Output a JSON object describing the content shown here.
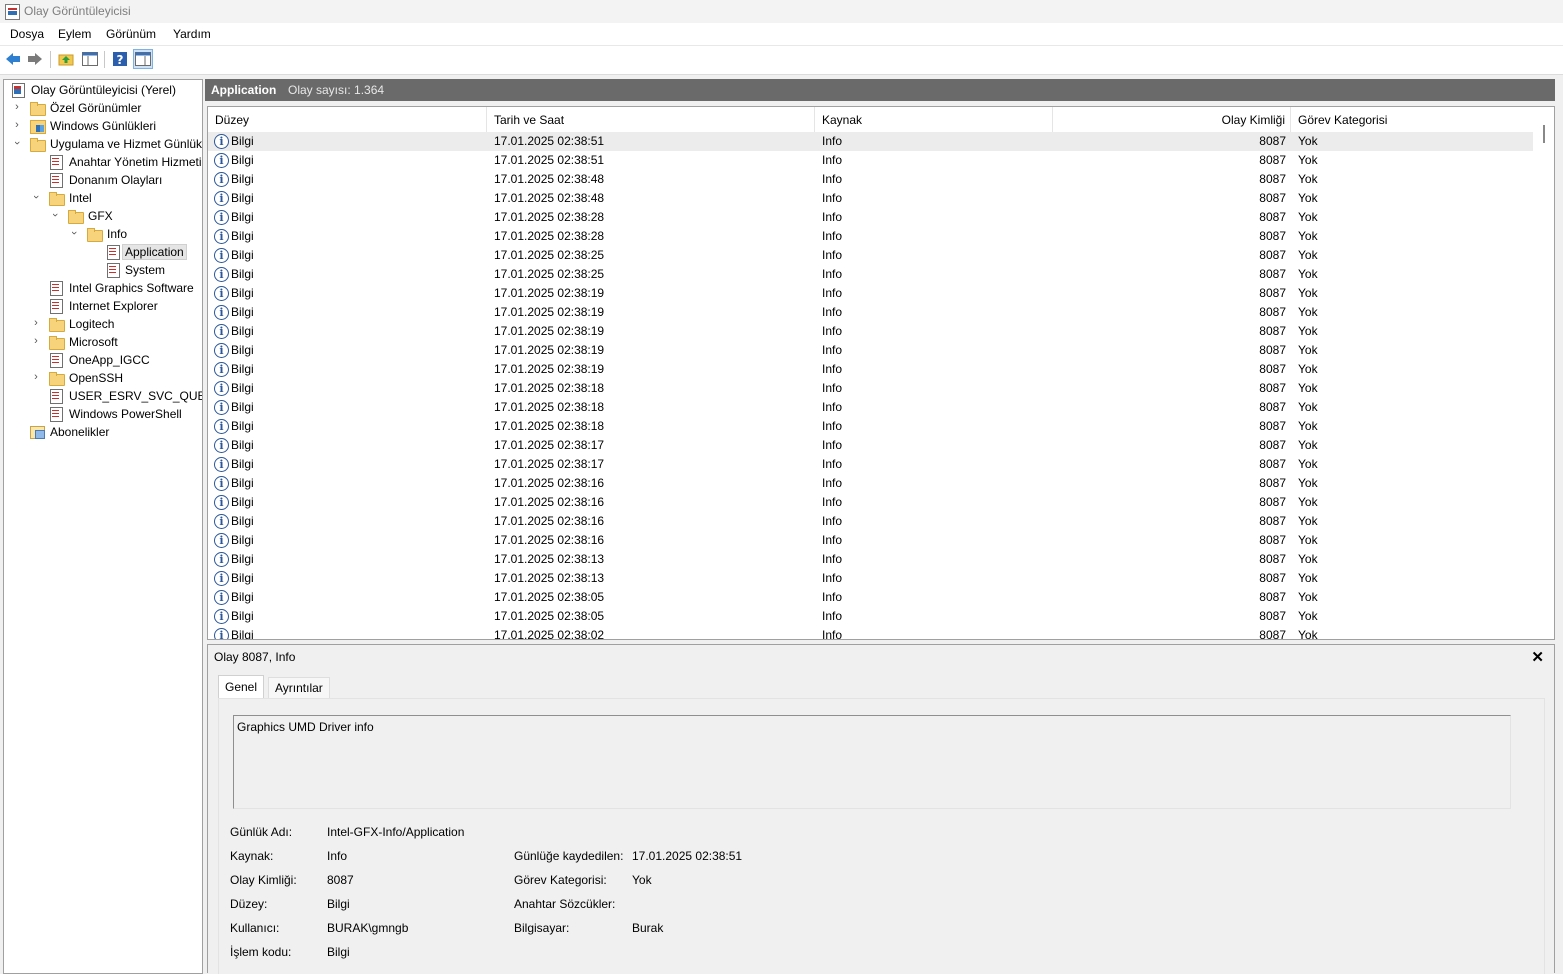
{
  "window": {
    "title": "Olay Görüntüleyicisi"
  },
  "menu": [
    "Dosya",
    "Eylem",
    "Görünüm",
    "Yardım"
  ],
  "toolbar": {
    "buttons": [
      "back-icon",
      "forward-icon",
      "up-folder-icon",
      "show-hide-tree-icon",
      "help-icon",
      "action-pane-icon"
    ]
  },
  "tree": {
    "items": [
      {
        "label": "Olay Görüntüleyicisi (Yerel)"
      },
      {
        "label": "Özel Görünümler"
      },
      {
        "label": "Windows Günlükleri"
      },
      {
        "label": "Uygulama ve Hizmet Günlükleri"
      },
      {
        "label": "Anahtar Yönetim Hizmeti"
      },
      {
        "label": "Donanım Olayları"
      },
      {
        "label": "Intel"
      },
      {
        "label": "GFX"
      },
      {
        "label": "Info"
      },
      {
        "label": "Application"
      },
      {
        "label": "System"
      },
      {
        "label": "Intel Graphics Software"
      },
      {
        "label": "Internet Explorer"
      },
      {
        "label": "Logitech"
      },
      {
        "label": "Microsoft"
      },
      {
        "label": "OneApp_IGCC"
      },
      {
        "label": "OpenSSH"
      },
      {
        "label": "USER_ESRV_SVC_QUEENCREEK"
      },
      {
        "label": "Windows PowerShell"
      },
      {
        "label": "Abonelikler"
      }
    ]
  },
  "panel": {
    "name": "Application",
    "count_text": "Olay sayısı: 1.364"
  },
  "grid": {
    "columns": [
      "Düzey",
      "Tarih ve Saat",
      "Kaynak",
      "Olay Kimliği",
      "Görev Kategorisi"
    ],
    "rows": [
      [
        "Bilgi",
        "17.01.2025 02:38:51",
        "Info",
        "8087",
        "Yok"
      ],
      [
        "Bilgi",
        "17.01.2025 02:38:51",
        "Info",
        "8087",
        "Yok"
      ],
      [
        "Bilgi",
        "17.01.2025 02:38:48",
        "Info",
        "8087",
        "Yok"
      ],
      [
        "Bilgi",
        "17.01.2025 02:38:48",
        "Info",
        "8087",
        "Yok"
      ],
      [
        "Bilgi",
        "17.01.2025 02:38:28",
        "Info",
        "8087",
        "Yok"
      ],
      [
        "Bilgi",
        "17.01.2025 02:38:28",
        "Info",
        "8087",
        "Yok"
      ],
      [
        "Bilgi",
        "17.01.2025 02:38:25",
        "Info",
        "8087",
        "Yok"
      ],
      [
        "Bilgi",
        "17.01.2025 02:38:25",
        "Info",
        "8087",
        "Yok"
      ],
      [
        "Bilgi",
        "17.01.2025 02:38:19",
        "Info",
        "8087",
        "Yok"
      ],
      [
        "Bilgi",
        "17.01.2025 02:38:19",
        "Info",
        "8087",
        "Yok"
      ],
      [
        "Bilgi",
        "17.01.2025 02:38:19",
        "Info",
        "8087",
        "Yok"
      ],
      [
        "Bilgi",
        "17.01.2025 02:38:19",
        "Info",
        "8087",
        "Yok"
      ],
      [
        "Bilgi",
        "17.01.2025 02:38:19",
        "Info",
        "8087",
        "Yok"
      ],
      [
        "Bilgi",
        "17.01.2025 02:38:18",
        "Info",
        "8087",
        "Yok"
      ],
      [
        "Bilgi",
        "17.01.2025 02:38:18",
        "Info",
        "8087",
        "Yok"
      ],
      [
        "Bilgi",
        "17.01.2025 02:38:18",
        "Info",
        "8087",
        "Yok"
      ],
      [
        "Bilgi",
        "17.01.2025 02:38:17",
        "Info",
        "8087",
        "Yok"
      ],
      [
        "Bilgi",
        "17.01.2025 02:38:17",
        "Info",
        "8087",
        "Yok"
      ],
      [
        "Bilgi",
        "17.01.2025 02:38:16",
        "Info",
        "8087",
        "Yok"
      ],
      [
        "Bilgi",
        "17.01.2025 02:38:16",
        "Info",
        "8087",
        "Yok"
      ],
      [
        "Bilgi",
        "17.01.2025 02:38:16",
        "Info",
        "8087",
        "Yok"
      ],
      [
        "Bilgi",
        "17.01.2025 02:38:16",
        "Info",
        "8087",
        "Yok"
      ],
      [
        "Bilgi",
        "17.01.2025 02:38:13",
        "Info",
        "8087",
        "Yok"
      ],
      [
        "Bilgi",
        "17.01.2025 02:38:13",
        "Info",
        "8087",
        "Yok"
      ],
      [
        "Bilgi",
        "17.01.2025 02:38:05",
        "Info",
        "8087",
        "Yok"
      ],
      [
        "Bilgi",
        "17.01.2025 02:38:05",
        "Info",
        "8087",
        "Yok"
      ],
      [
        "Bilgi",
        "17.01.2025 02:38:02",
        "Info",
        "8087",
        "Yok"
      ]
    ]
  },
  "detail": {
    "title": "Olay 8087, Info",
    "close": "✕",
    "tabs": [
      "Genel",
      "Ayrıntılar"
    ],
    "message": "Graphics UMD Driver info",
    "fields": {
      "log_name_label": "Günlük Adı:",
      "log_name": "Intel-GFX-Info/Application",
      "source_label": "Kaynak:",
      "source": "Info",
      "logged_label": "Günlüğe kaydedilen:",
      "logged": "17.01.2025 02:38:51",
      "event_id_label": "Olay Kimliği:",
      "event_id": "8087",
      "task_label": "Görev Kategorisi:",
      "task": "Yok",
      "level_label": "Düzey:",
      "level": "Bilgi",
      "keywords_label": "Anahtar Sözcükler:",
      "keywords": "",
      "user_label": "Kullanıcı:",
      "user": "BURAK\\gmngb",
      "computer_label": "Bilgisayar:",
      "computer": "Burak",
      "opcode_label": "İşlem kodu:",
      "opcode": "Bilgi"
    }
  }
}
